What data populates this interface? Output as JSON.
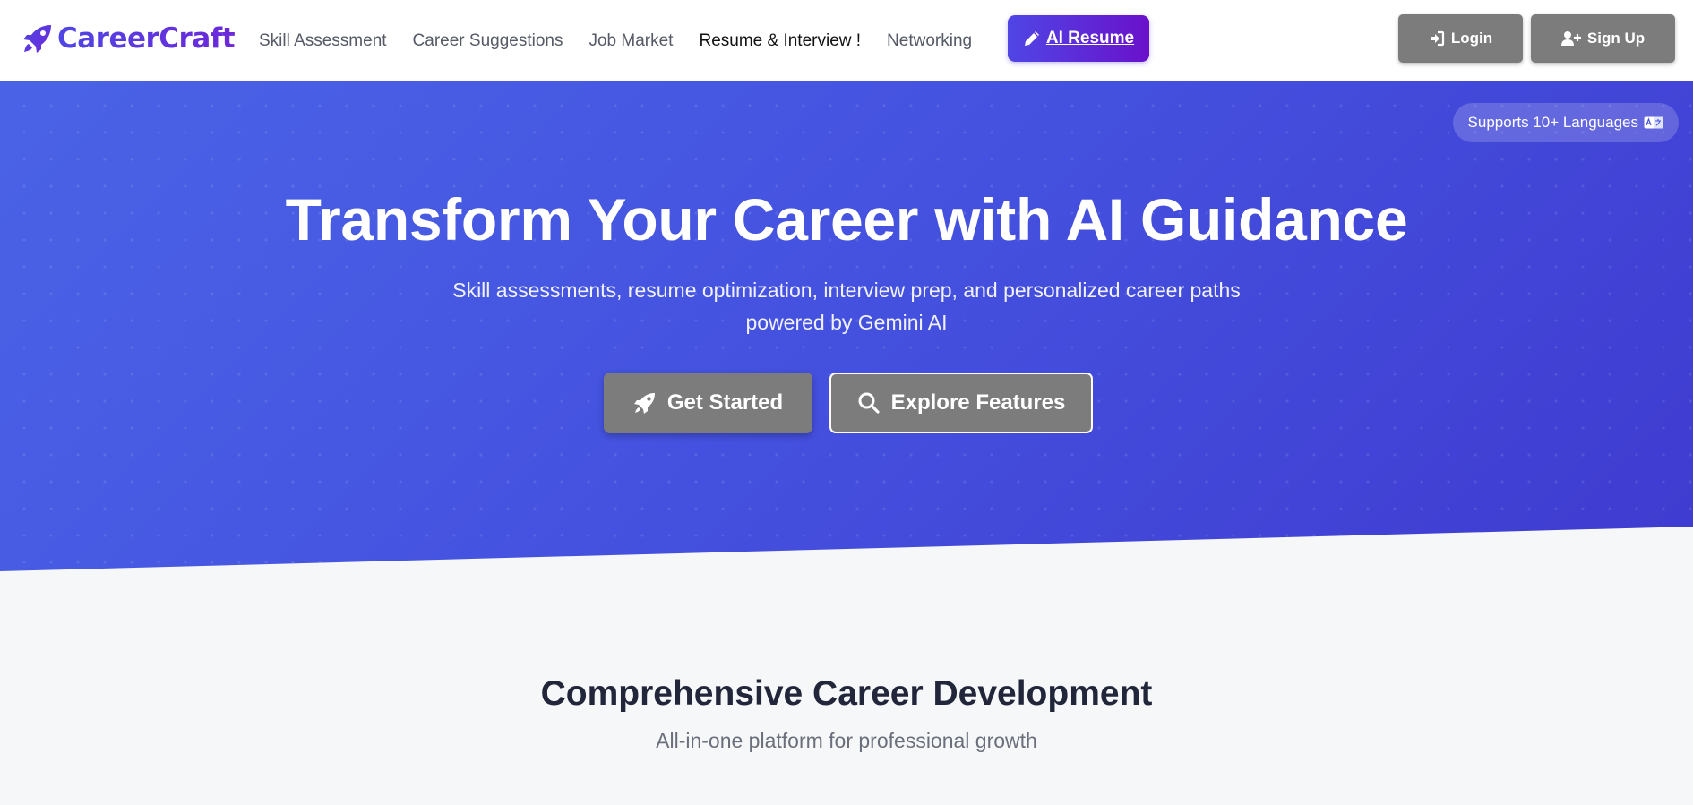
{
  "brand": {
    "name": "CareerCraft",
    "icon": "rocket-icon"
  },
  "nav": {
    "links": [
      {
        "label": "Skill Assessment",
        "active": false
      },
      {
        "label": "Career Suggestions",
        "active": false
      },
      {
        "label": "Job Market",
        "active": false
      },
      {
        "label": "Resume & Interview !",
        "active": true
      },
      {
        "label": "Networking",
        "active": false
      }
    ],
    "ai_resume": {
      "label": "AI Resume",
      "icon": "pen-icon"
    }
  },
  "auth": {
    "login": {
      "label": "Login",
      "icon": "sign-in-icon"
    },
    "signup": {
      "label": "Sign Up",
      "icon": "user-plus-icon"
    }
  },
  "hero": {
    "language_badge": "Supports 10+ Languages",
    "language_icon": "language-icon",
    "title": "Transform Your Career with AI Guidance",
    "subtitle_line1": "Skill assessments, resume optimization, interview prep, and personalized career paths",
    "subtitle_line2": "powered by Gemini AI",
    "get_started": {
      "label": "Get Started",
      "icon": "rocket-icon"
    },
    "explore": {
      "label": "Explore Features",
      "icon": "search-icon"
    }
  },
  "features": {
    "title": "Comprehensive Career Development",
    "subtitle": "All-in-one platform for professional growth"
  },
  "colors": {
    "brand_gradient_start": "#4f46e5",
    "brand_gradient_end": "#6d28d9",
    "hero_start": "#4a63e6",
    "hero_end": "#3f3bd0",
    "gray_button": "#7c7c7c",
    "section_bg": "#f6f7f9"
  }
}
